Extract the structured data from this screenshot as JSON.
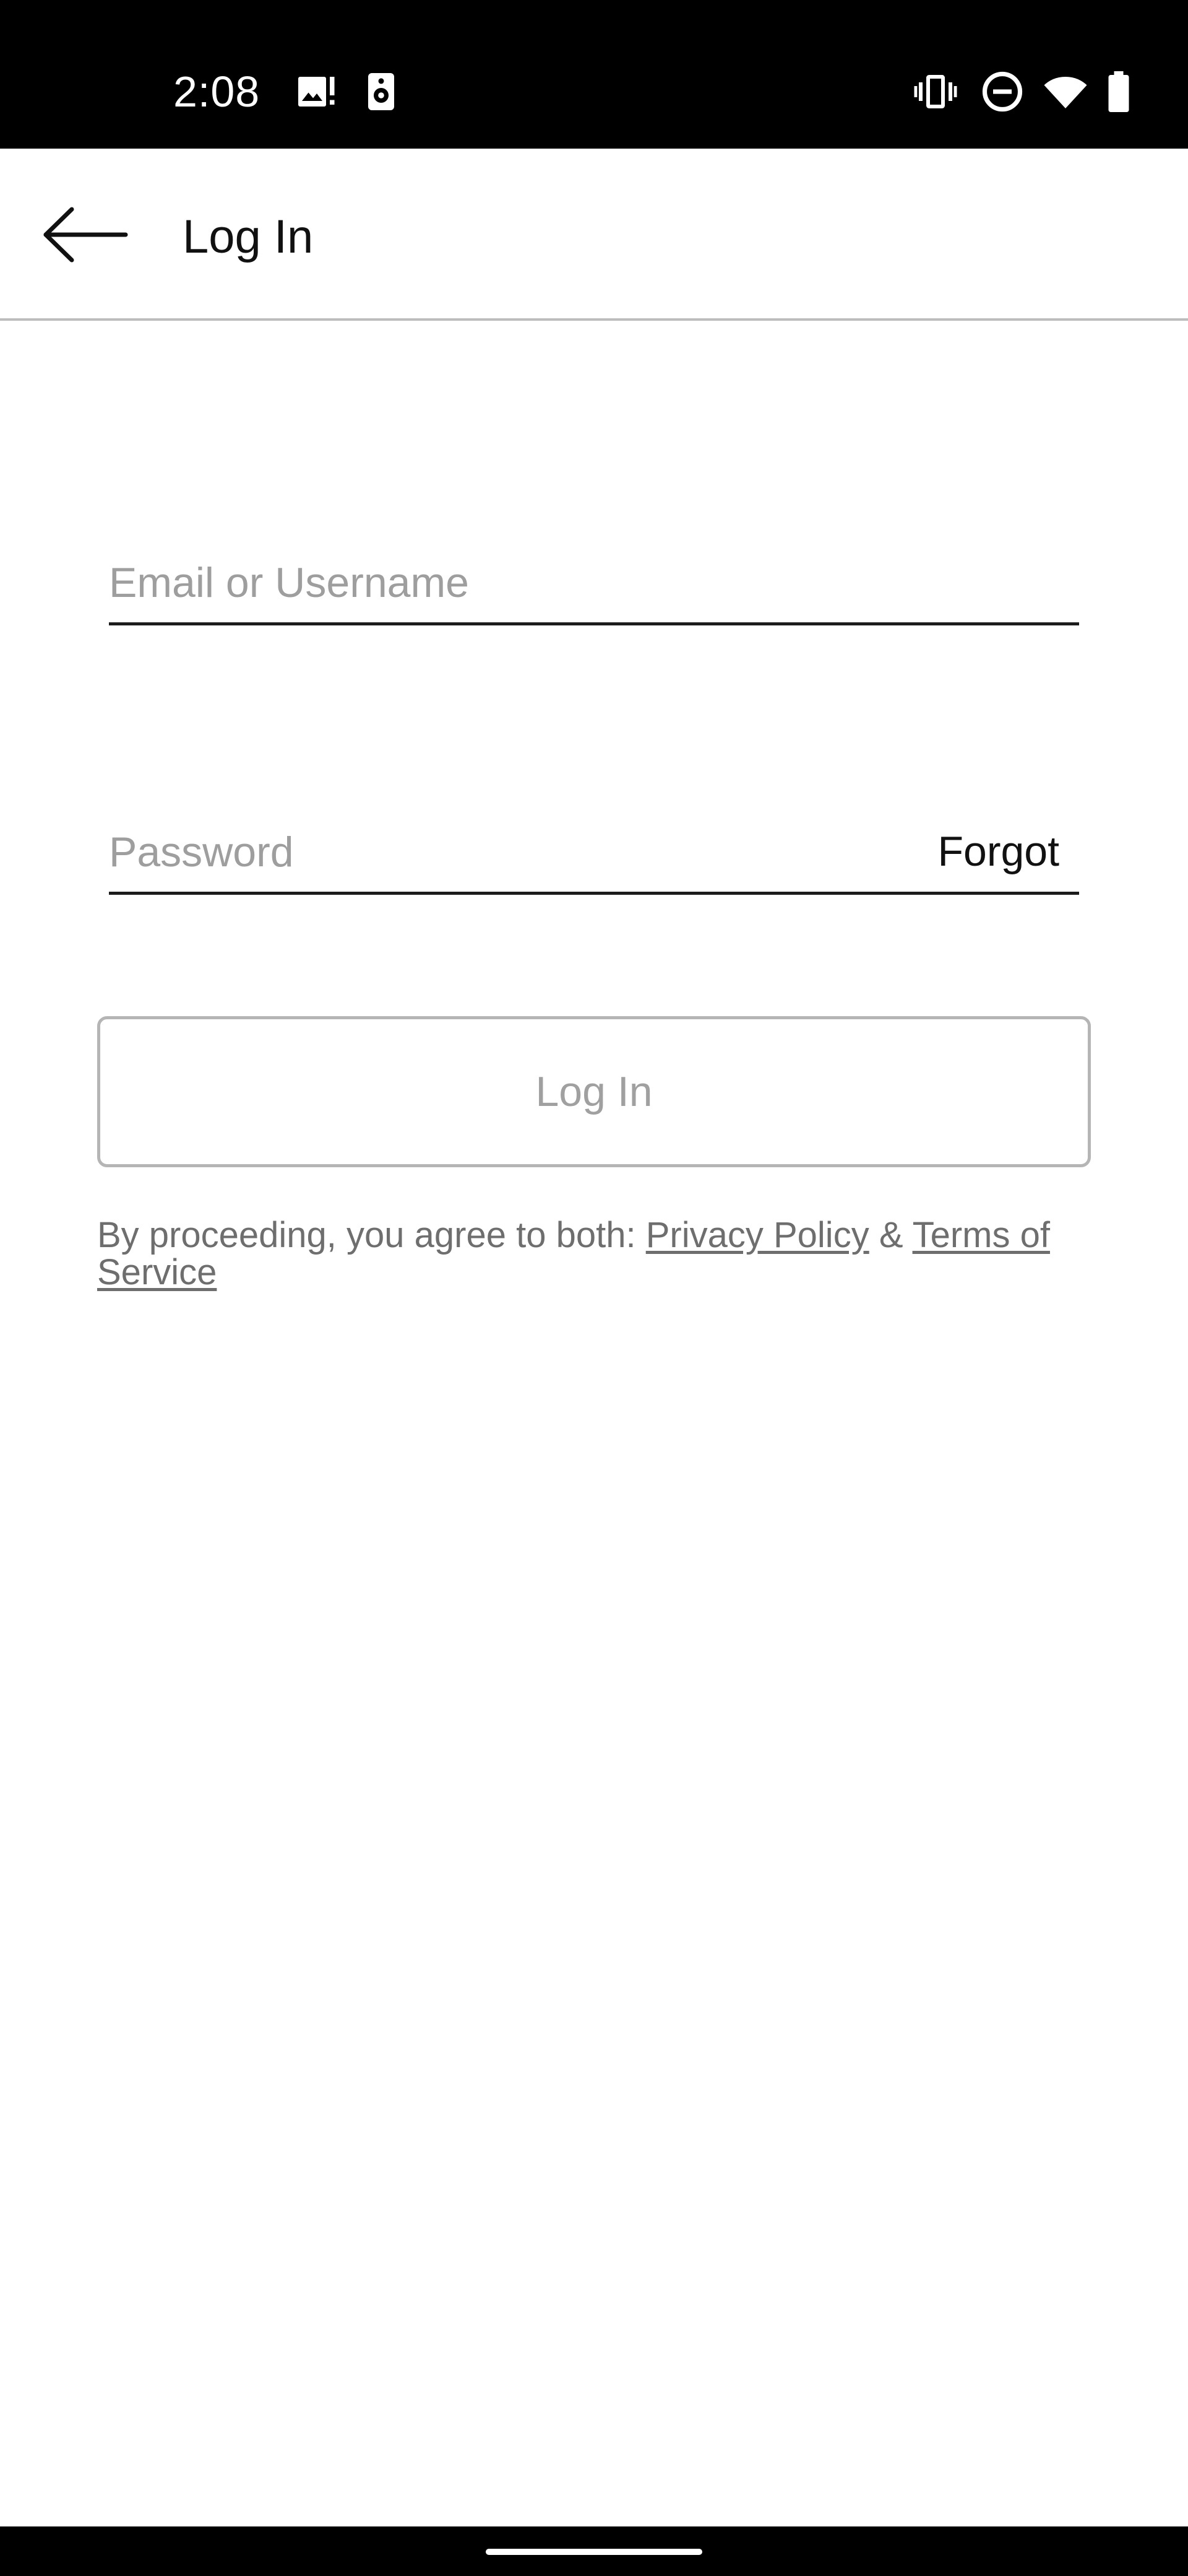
{
  "status_bar": {
    "time": "2:08",
    "icons": [
      "image-notification-icon",
      "speaker-icon",
      "vibrate-icon",
      "do-not-disturb-icon",
      "wifi-icon",
      "battery-icon"
    ]
  },
  "header": {
    "title": "Log In",
    "back_icon": "arrow-left-icon"
  },
  "form": {
    "email_placeholder": "Email or Username",
    "email_value": "",
    "password_placeholder": "Password",
    "password_value": "",
    "forgot_label": "Forgot",
    "login_label": "Log In"
  },
  "legal": {
    "prefix": "By proceeding, you agree to both: ",
    "privacy_label": "Privacy Policy",
    "separator": " & ",
    "terms_label": "Terms of Service"
  },
  "colors": {
    "status_bar_bg": "#000000",
    "text_primary": "#111111",
    "text_muted": "#9e9e9e",
    "button_border": "#b5b5b5"
  }
}
